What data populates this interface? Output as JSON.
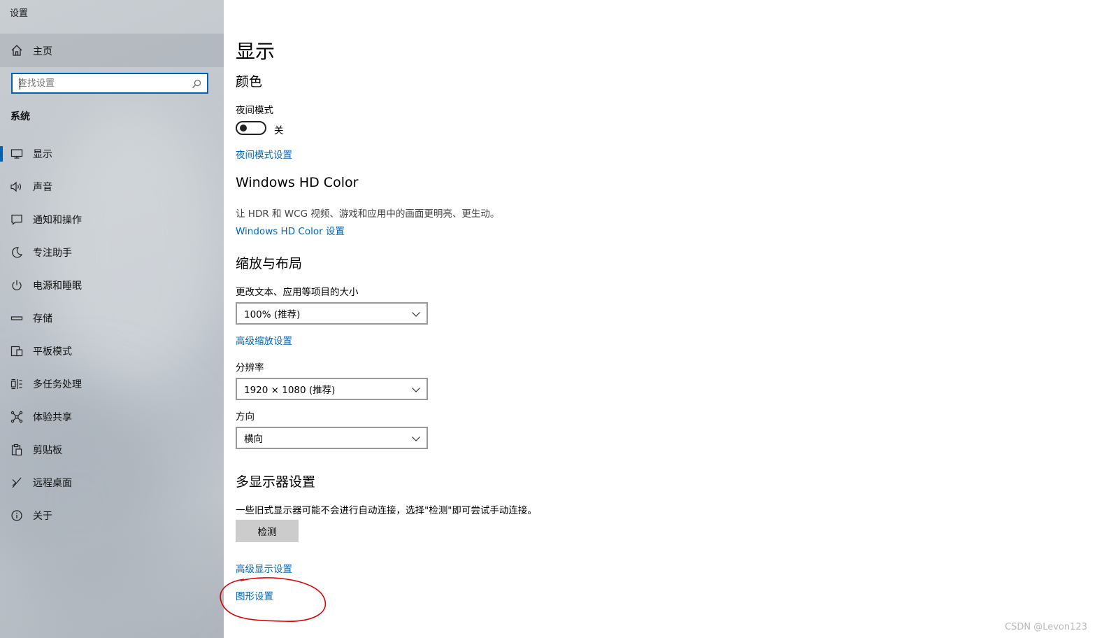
{
  "window": {
    "title": "设置"
  },
  "sidebar": {
    "home_label": "主页",
    "search_placeholder": "查找设置",
    "group_heading": "系统",
    "items": [
      {
        "label": "显示",
        "icon": "monitor-icon",
        "active": true
      },
      {
        "label": "声音",
        "icon": "speaker-icon"
      },
      {
        "label": "通知和操作",
        "icon": "message-icon"
      },
      {
        "label": "专注助手",
        "icon": "moon-icon"
      },
      {
        "label": "电源和睡眠",
        "icon": "power-icon"
      },
      {
        "label": "存储",
        "icon": "storage-icon"
      },
      {
        "label": "平板模式",
        "icon": "tablet-icon"
      },
      {
        "label": "多任务处理",
        "icon": "multitask-icon"
      },
      {
        "label": "体验共享",
        "icon": "share-icon"
      },
      {
        "label": "剪贴板",
        "icon": "clipboard-icon"
      },
      {
        "label": "远程桌面",
        "icon": "remote-icon"
      },
      {
        "label": "关于",
        "icon": "info-icon"
      }
    ]
  },
  "main": {
    "title": "显示",
    "color": {
      "heading": "颜色",
      "night_mode_label": "夜间模式",
      "night_mode_state": "关",
      "night_mode_link": "夜间模式设置"
    },
    "hdr": {
      "heading": "Windows HD Color",
      "description": "让 HDR 和 WCG 视频、游戏和应用中的画面更明亮、更生动。",
      "link": "Windows HD Color 设置"
    },
    "scale": {
      "heading": "缩放与布局",
      "size_label": "更改文本、应用等项目的大小",
      "size_value": "100% (推荐)",
      "advanced_link": "高级缩放设置",
      "resolution_label": "分辨率",
      "resolution_value": "1920 × 1080 (推荐)",
      "orientation_label": "方向",
      "orientation_value": "横向"
    },
    "multi": {
      "heading": "多显示器设置",
      "description": "一些旧式显示器可能不会进行自动连接，选择\"检测\"即可尝试手动连接。",
      "detect_button": "检测",
      "advanced_link": "高级显示设置",
      "graphics_link": "图形设置"
    }
  },
  "annotation": {
    "color": "#e00000"
  },
  "watermark": "CSDN @Levon123",
  "colors": {
    "accent": "#0063b1",
    "link": "#0067c0"
  }
}
